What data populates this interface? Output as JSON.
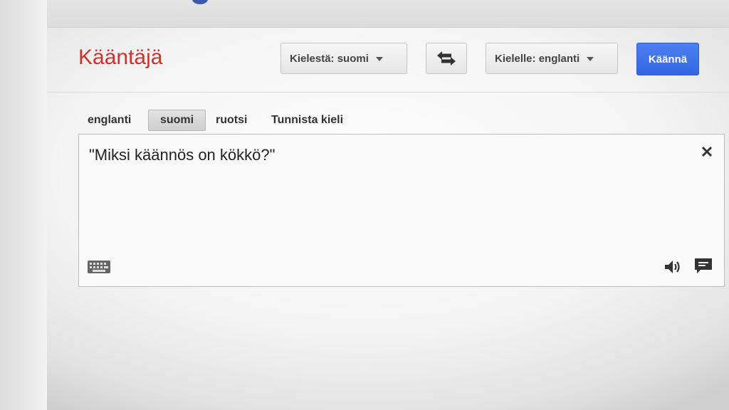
{
  "app": {
    "title": "Kääntäjä"
  },
  "toolbar": {
    "source_language_label": "Kielestä: suomi",
    "target_language_label": "Kielelle: englanti",
    "swap_icon": "swap-arrows-icon",
    "translate_label": "Käännä"
  },
  "source_tabs": [
    {
      "label": "englanti",
      "selected": false
    },
    {
      "label": "suomi",
      "selected": true
    },
    {
      "label": "ruotsi",
      "selected": false
    },
    {
      "label": "Tunnista kieli",
      "selected": false
    }
  ],
  "input": {
    "value": "\"Miksi käännös on kökkö?\""
  },
  "icons": {
    "clear": "close-icon",
    "keyboard": "keyboard-icon",
    "speaker": "speaker-icon",
    "feedback": "feedback-icon"
  },
  "colors": {
    "title": "#d0312b",
    "accent": "#3366e4"
  }
}
